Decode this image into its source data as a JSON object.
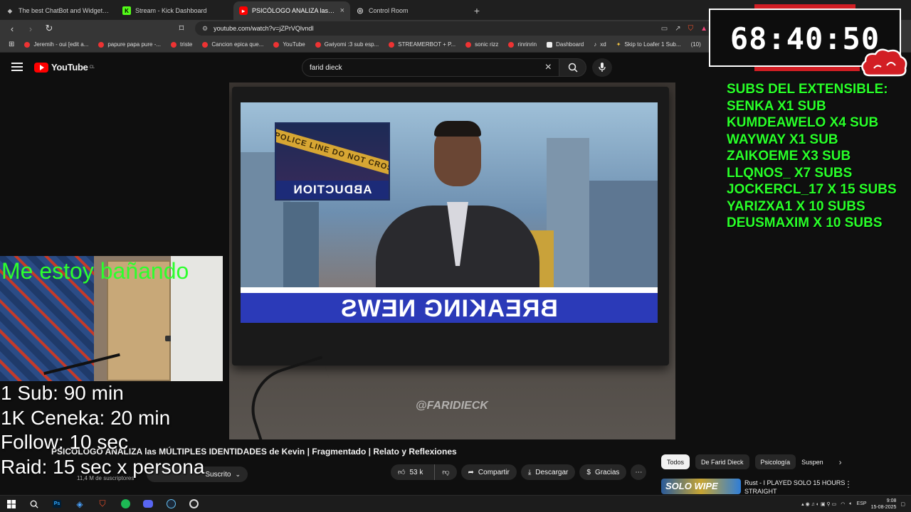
{
  "browser": {
    "tabs": [
      {
        "title": "The best ChatBot and Widgets for Ki",
        "favicon_color": "#9aa0a6",
        "active": false
      },
      {
        "title": "Stream - Kick Dashboard",
        "favicon_color": "#53fc18",
        "active": false
      },
      {
        "title": "PSICÓLOGO ANALIZA las MÚ",
        "favicon_color": "#ff0000",
        "active": true
      },
      {
        "title": "Control Room",
        "favicon_color": "#dddddd",
        "active": false
      }
    ],
    "url": "youtube.com/watch?v=jZPrVQlvndI",
    "bookmarks": [
      {
        "label": "Jeremih - oui [edit a..."
      },
      {
        "label": "papure papa pure -..."
      },
      {
        "label": "triste"
      },
      {
        "label": "Cancion epica que..."
      },
      {
        "label": "YouTube"
      },
      {
        "label": "Gwiyomi :3 sub esp..."
      },
      {
        "label": "STREAMERBOT + P..."
      },
      {
        "label": "sonic rizz"
      },
      {
        "label": "rinrinrin"
      },
      {
        "label": "Dashboard"
      },
      {
        "label": "xd"
      },
      {
        "label": "Skip to Loafer 1 Sub..."
      },
      {
        "label": "(10)"
      }
    ]
  },
  "youtube": {
    "logo_text": "YouTube",
    "region": "CL",
    "search_value": "farid dieck",
    "video": {
      "inset_caption": "ABDUCTION",
      "tape_text": "POLICE LINE DO NOT CROSS",
      "breaking_text": "BREAKING NEWS",
      "watermark": "@FARIDIECK",
      "title": "PSICÓLOGO ANALIZA las MÚLTIPLES IDENTIDADES de Kevin | Fragmentado | Relato y Reflexiones",
      "subscribers": "11,4 M de suscriptores",
      "subscribe_label": "Suscrito",
      "likes": "53 k",
      "share_label": "Compartir",
      "download_label": "Descargar",
      "thanks_label": "Gracias"
    },
    "chips": [
      "Todos",
      "De Farid Dieck",
      "Psicología",
      "Suspen"
    ],
    "recommended": {
      "title": "Rust - I PLAYED SOLO 15 HOURS STRAIGHT",
      "thumb_text": "SOLO WIPE"
    }
  },
  "overlay": {
    "timer": "68:40:50",
    "subs_header": "SUBS DEL EXTENSIBLE:",
    "subs": [
      "SENKA X1 SUB",
      "KUMDEAWELO X4 SUB",
      "WAYWAY X1 SUB",
      "ZAIKOEME X3 SUB",
      "LLQNOS_ X7 SUBS",
      "JOCKERCL_17 X 15 SUBS",
      "YARIZXA1 X 10 SUBS",
      "DEUSMAXIM X 10 SUBS"
    ],
    "webcam_caption": "Me estoy bañando",
    "rates": [
      "1 Sub: 90 min",
      "1K Ceneka: 20 min",
      "Follow: 10 sec",
      "Raid: 15 sec x persona"
    ]
  },
  "taskbar": {
    "lang": "ESP",
    "time": "9:08",
    "date": "15-08-2025"
  }
}
